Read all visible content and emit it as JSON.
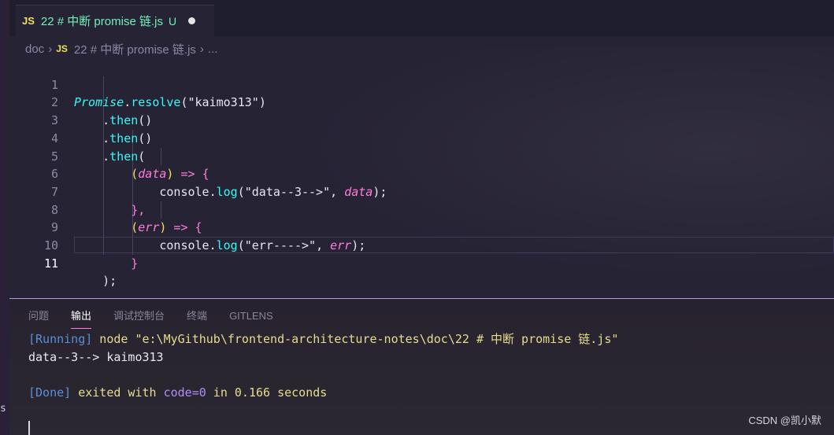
{
  "tab": {
    "badge": "JS",
    "title": "22 # 中断 promise 链.js",
    "status": "U"
  },
  "breadcrumb": {
    "folder": "doc",
    "badge": "JS",
    "file": "22 # 中断 promise 链.js",
    "more": "..."
  },
  "editor": {
    "line_numbers": [
      "1",
      "2",
      "3",
      "4",
      "5",
      "6",
      "7",
      "8",
      "9",
      "10",
      "11"
    ],
    "active_line": "11",
    "code": {
      "l1": {
        "a": "Promise",
        "b": ".",
        "c": "resolve",
        "d": "(",
        "e": "\"kaimo313\"",
        "f": ")"
      },
      "l2": {
        "a": ".",
        "b": "then",
        "c": "()"
      },
      "l3": {
        "a": ".",
        "b": "then",
        "c": "()"
      },
      "l4": {
        "a": ".",
        "b": "then",
        "c": "("
      },
      "l5": {
        "a": "(",
        "b": "data",
        "c": ")",
        "d": " => ",
        "e": "{"
      },
      "l6": {
        "a": "console",
        "b": ".",
        "c": "log",
        "d": "(",
        "e": "\"data--3-->\"",
        "f": ", ",
        "g": "data",
        "h": ");"
      },
      "l7": {
        "a": "},"
      },
      "l8": {
        "a": "(",
        "b": "err",
        "c": ")",
        "d": " => ",
        "e": "{"
      },
      "l9": {
        "a": "console",
        "b": ".",
        "c": "log",
        "d": "(",
        "e": "\"err---->\"",
        "f": ", ",
        "g": "err",
        "h": ");"
      },
      "l10": {
        "a": "}"
      },
      "l11": {
        "a": ");"
      }
    }
  },
  "panel": {
    "tabs": [
      "问题",
      "输出",
      "调试控制台",
      "终端",
      "GITLENS"
    ],
    "active_tab": "输出",
    "output": {
      "l1": {
        "tag": "[Running]",
        "cmd": " node \"e:\\MyGithub\\frontend-architecture-notes\\doc\\22 # 中断 promise 链.js\""
      },
      "l2": "data--3--> kaimo313",
      "l3": {
        "tag": "[Done]",
        "a": " exited with ",
        "code": "code=0",
        "b": " in ",
        "num": "0.166",
        "c": " seconds"
      }
    }
  },
  "watermark": "CSDN @凯小默",
  "left_edge_char": "s",
  "colors": {
    "background": "#262335",
    "accent_pink": "#ff7edb",
    "cyan": "#36f9f6",
    "string_orange": "#ff8b39",
    "tab_green": "#72f1b8"
  }
}
